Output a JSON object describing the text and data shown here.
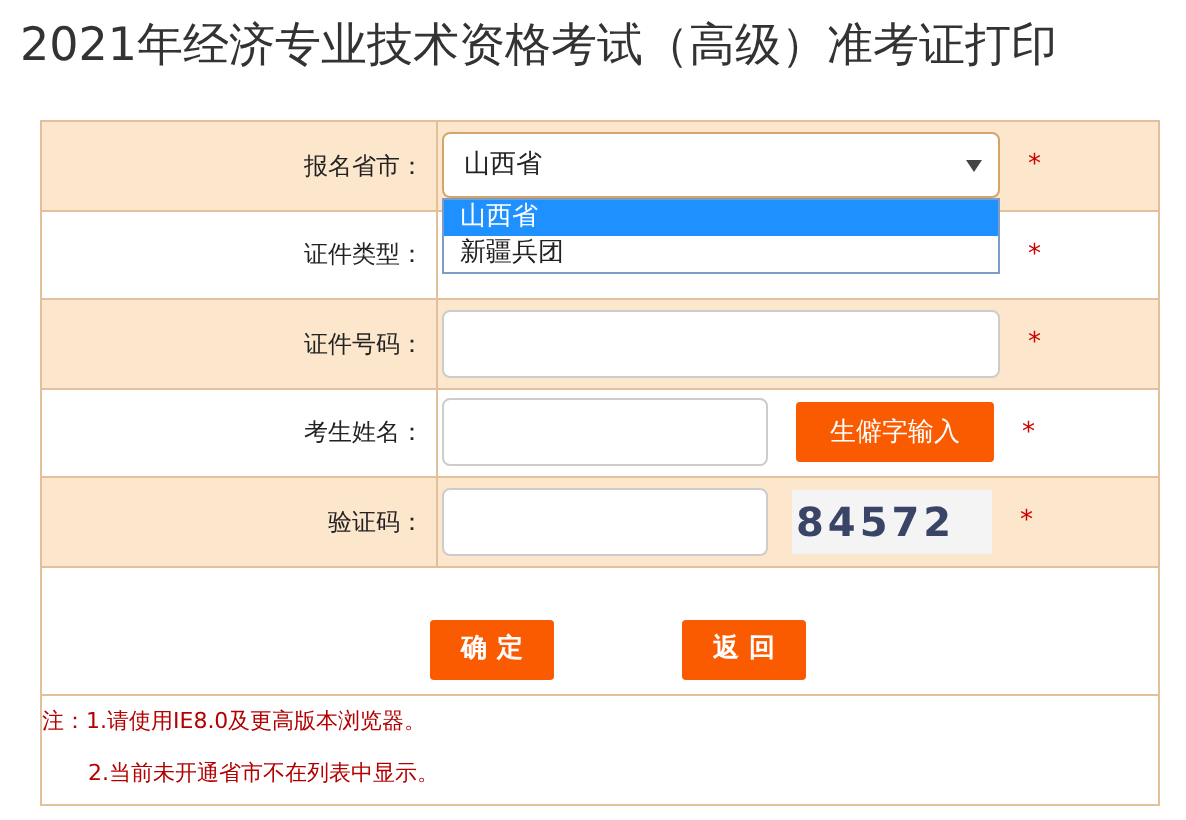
{
  "title": "2021年经济专业技术资格考试（高级）准考证打印",
  "form_rows": [
    {
      "label": "报名省市：",
      "kind": "select",
      "value": "山西省",
      "required": true,
      "options": [
        {
          "label": "山西省",
          "selected": true
        },
        {
          "label": "新疆兵团",
          "selected": false
        }
      ]
    },
    {
      "label": "证件类型：",
      "kind": "hidden",
      "required": true
    },
    {
      "label": "证件号码：",
      "kind": "text",
      "required": true
    },
    {
      "label": "考生姓名：",
      "kind": "text_with_button",
      "button": "生僻字输入",
      "required": true
    },
    {
      "label": "验证码：",
      "kind": "captcha",
      "captcha": "84572",
      "required": true
    }
  ],
  "required_mark": "*",
  "buttons": [
    "确 定",
    "返 回"
  ],
  "notes": [
    "注：1.请使用IE8.0及更高版本浏览器。",
    "2.当前未开通省市不在列表中显示。"
  ]
}
